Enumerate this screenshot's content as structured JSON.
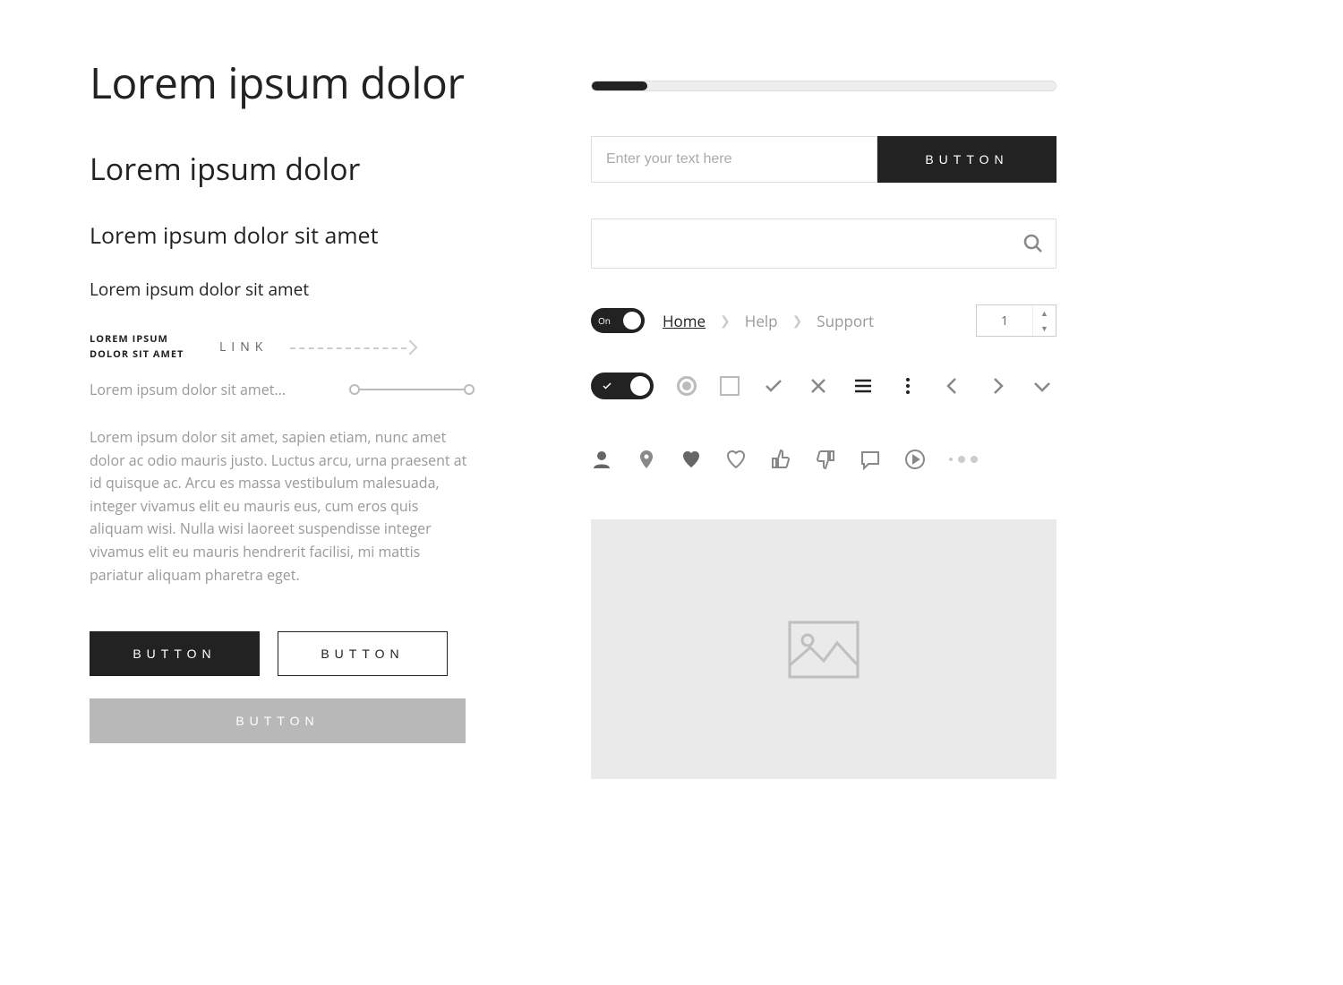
{
  "typography": {
    "h1": "Lorem ipsum dolor",
    "h2": "Lorem ipsum dolor",
    "h3": "Lorem ipsum dolor sit amet",
    "h4": "Lorem ipsum dolor sit amet",
    "tag_label": "LOREM IPSUM DOLOR SIT AMET",
    "link_label": "LINK",
    "short_text": "Lorem ipsum dolor sit amet...",
    "body": "Lorem ipsum dolor sit amet, sapien etiam, nunc amet dolor ac odio mauris justo. Luctus arcu, urna praesent at id quisque ac. Arcu es massa vestibulum malesuada, integer vivamus elit eu mauris eus, cum eros quis aliquam wisi. Nulla wisi laoreet suspendisse integer vivamus elit eu mauris hendrerit facilisi, mi mattis pariatur aliquam pharetra eget."
  },
  "buttons": {
    "primary": "BUTTON",
    "outline": "BUTTON",
    "disabled": "BUTTON",
    "attached": "BUTTON"
  },
  "inputs": {
    "text_placeholder": "Enter your text here",
    "search_value": ""
  },
  "progress": {
    "percent": 12
  },
  "toggle": {
    "label": "On",
    "state": true
  },
  "breadcrumb": {
    "items": [
      "Home",
      "Help",
      "Support"
    ],
    "active_index": 0
  },
  "stepper": {
    "value": "1"
  },
  "icons": {
    "row1": [
      "radio-checked",
      "checkbox",
      "check",
      "close",
      "menu",
      "more-vertical",
      "chevron-left",
      "chevron-right",
      "chevron-down"
    ],
    "row2": [
      "user",
      "pin",
      "heart-filled",
      "heart-outline",
      "thumbs-up",
      "thumbs-down",
      "comment",
      "play-circle",
      "pagination-dots"
    ]
  }
}
